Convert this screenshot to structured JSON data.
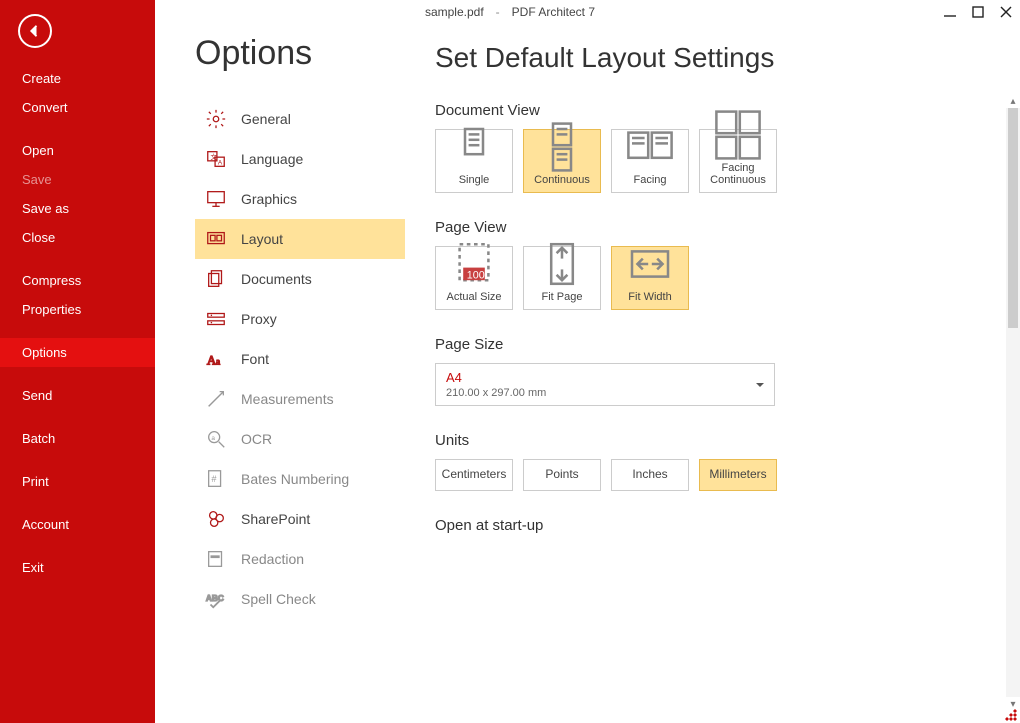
{
  "titlebar": {
    "document": "sample.pdf",
    "separator": "-",
    "app": "PDF Architect 7"
  },
  "sidebar": {
    "groups": [
      [
        {
          "id": "create",
          "label": "Create",
          "disabled": false
        },
        {
          "id": "convert",
          "label": "Convert",
          "disabled": false
        }
      ],
      [
        {
          "id": "open",
          "label": "Open",
          "disabled": false
        },
        {
          "id": "save",
          "label": "Save",
          "disabled": true
        },
        {
          "id": "saveas",
          "label": "Save as",
          "disabled": false
        },
        {
          "id": "close",
          "label": "Close",
          "disabled": false
        }
      ],
      [
        {
          "id": "compress",
          "label": "Compress",
          "disabled": false
        },
        {
          "id": "properties",
          "label": "Properties",
          "disabled": false
        }
      ],
      [
        {
          "id": "options",
          "label": "Options",
          "disabled": false,
          "selected": true
        }
      ],
      [
        {
          "id": "send",
          "label": "Send",
          "disabled": false
        }
      ],
      [
        {
          "id": "batch",
          "label": "Batch",
          "disabled": false
        }
      ],
      [
        {
          "id": "print",
          "label": "Print",
          "disabled": false
        }
      ],
      [
        {
          "id": "account",
          "label": "Account",
          "disabled": false
        }
      ],
      [
        {
          "id": "exit",
          "label": "Exit",
          "disabled": false
        }
      ]
    ]
  },
  "settings_nav": {
    "title": "Options",
    "items": [
      {
        "id": "general",
        "label": "General",
        "icon": "gear-icon"
      },
      {
        "id": "language",
        "label": "Language",
        "icon": "language-icon"
      },
      {
        "id": "graphics",
        "label": "Graphics",
        "icon": "monitor-icon"
      },
      {
        "id": "layout",
        "label": "Layout",
        "icon": "layout-icon",
        "selected": true
      },
      {
        "id": "documents",
        "label": "Documents",
        "icon": "documents-icon"
      },
      {
        "id": "proxy",
        "label": "Proxy",
        "icon": "proxy-icon"
      },
      {
        "id": "font",
        "label": "Font",
        "icon": "font-icon"
      },
      {
        "id": "measurements",
        "label": "Measurements",
        "icon": "ruler-icon",
        "muted": true
      },
      {
        "id": "ocr",
        "label": "OCR",
        "icon": "search-icon",
        "muted": true
      },
      {
        "id": "bates",
        "label": "Bates Numbering",
        "icon": "hash-icon",
        "muted": true
      },
      {
        "id": "sharepoint",
        "label": "SharePoint",
        "icon": "sharepoint-icon"
      },
      {
        "id": "redaction",
        "label": "Redaction",
        "icon": "redaction-icon",
        "muted": true
      },
      {
        "id": "spellcheck",
        "label": "Spell Check",
        "icon": "spellcheck-icon",
        "muted": true
      }
    ]
  },
  "panel": {
    "title": "Set Default Layout Settings",
    "sections": {
      "document_view": {
        "title": "Document View",
        "options": [
          {
            "id": "single",
            "label": "Single"
          },
          {
            "id": "continuous",
            "label": "Continuous",
            "selected": true
          },
          {
            "id": "facing",
            "label": "Facing"
          },
          {
            "id": "facingcont",
            "label": "Facing Continuous"
          }
        ]
      },
      "page_view": {
        "title": "Page View",
        "options": [
          {
            "id": "actual",
            "label": "Actual Size"
          },
          {
            "id": "fitpage",
            "label": "Fit Page"
          },
          {
            "id": "fitwidth",
            "label": "Fit Width",
            "selected": true
          }
        ]
      },
      "page_size": {
        "title": "Page Size",
        "selected_name": "A4",
        "selected_dim": "210.00 x 297.00 mm"
      },
      "units": {
        "title": "Units",
        "options": [
          {
            "id": "cm",
            "label": "Centimeters"
          },
          {
            "id": "pt",
            "label": "Points"
          },
          {
            "id": "in",
            "label": "Inches"
          },
          {
            "id": "mm",
            "label": "Millimeters",
            "selected": true
          }
        ]
      },
      "startup": {
        "title": "Open at start-up"
      }
    }
  }
}
